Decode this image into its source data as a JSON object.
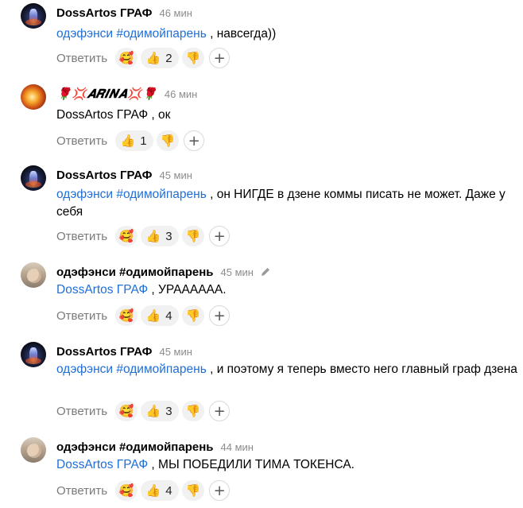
{
  "reply_label": "Ответить",
  "plus_symbol": "+",
  "icons": {
    "thumb_up": "👍",
    "thumb_down": "👎",
    "reaction": "🥰",
    "edit": "pencil-icon"
  },
  "colors": {
    "mention": "#1f6fd8",
    "time": "#8c8c8c",
    "reply": "#7a7a7a",
    "pill": "#f1f1f1"
  },
  "comments": [
    {
      "author": "DossArtos ГРАФ",
      "time": "46 мин",
      "mention": "одэфэнси #одимойпарень",
      "text": " , навсегда))",
      "likes": "2"
    },
    {
      "author": "🌹💢𝑨𝑹𝑰𝑵𝑨💢🌹",
      "time": "46 мин",
      "mention": "",
      "text": "DossArtos ГРАФ , ок",
      "likes": "1"
    },
    {
      "author": "DossArtos ГРАФ",
      "time": "45 мин",
      "mention": "одэфэнси #одимойпарень",
      "text": " , он НИГДЕ в дзене коммы писать не может. Даже у себя",
      "likes": "3"
    },
    {
      "author": "одэфэнси #одимойпарень",
      "time": "45 мин",
      "mention": "DossArtos ГРАФ",
      "text": " , УРАААААА.",
      "likes": "4"
    },
    {
      "author": "DossArtos ГРАФ",
      "time": "45 мин",
      "mention": "одэфэнси #одимойпарень",
      "text": " , и поэтому я теперь вместо него главный граф дзена",
      "likes": "3"
    },
    {
      "author": "одэфэнси #одимойпарень",
      "time": "44 мин",
      "mention": "DossArtos ГРАФ",
      "text": " , МЫ ПОБЕДИЛИ ТИМА ТОКЕНСА.",
      "likes": "4"
    }
  ]
}
